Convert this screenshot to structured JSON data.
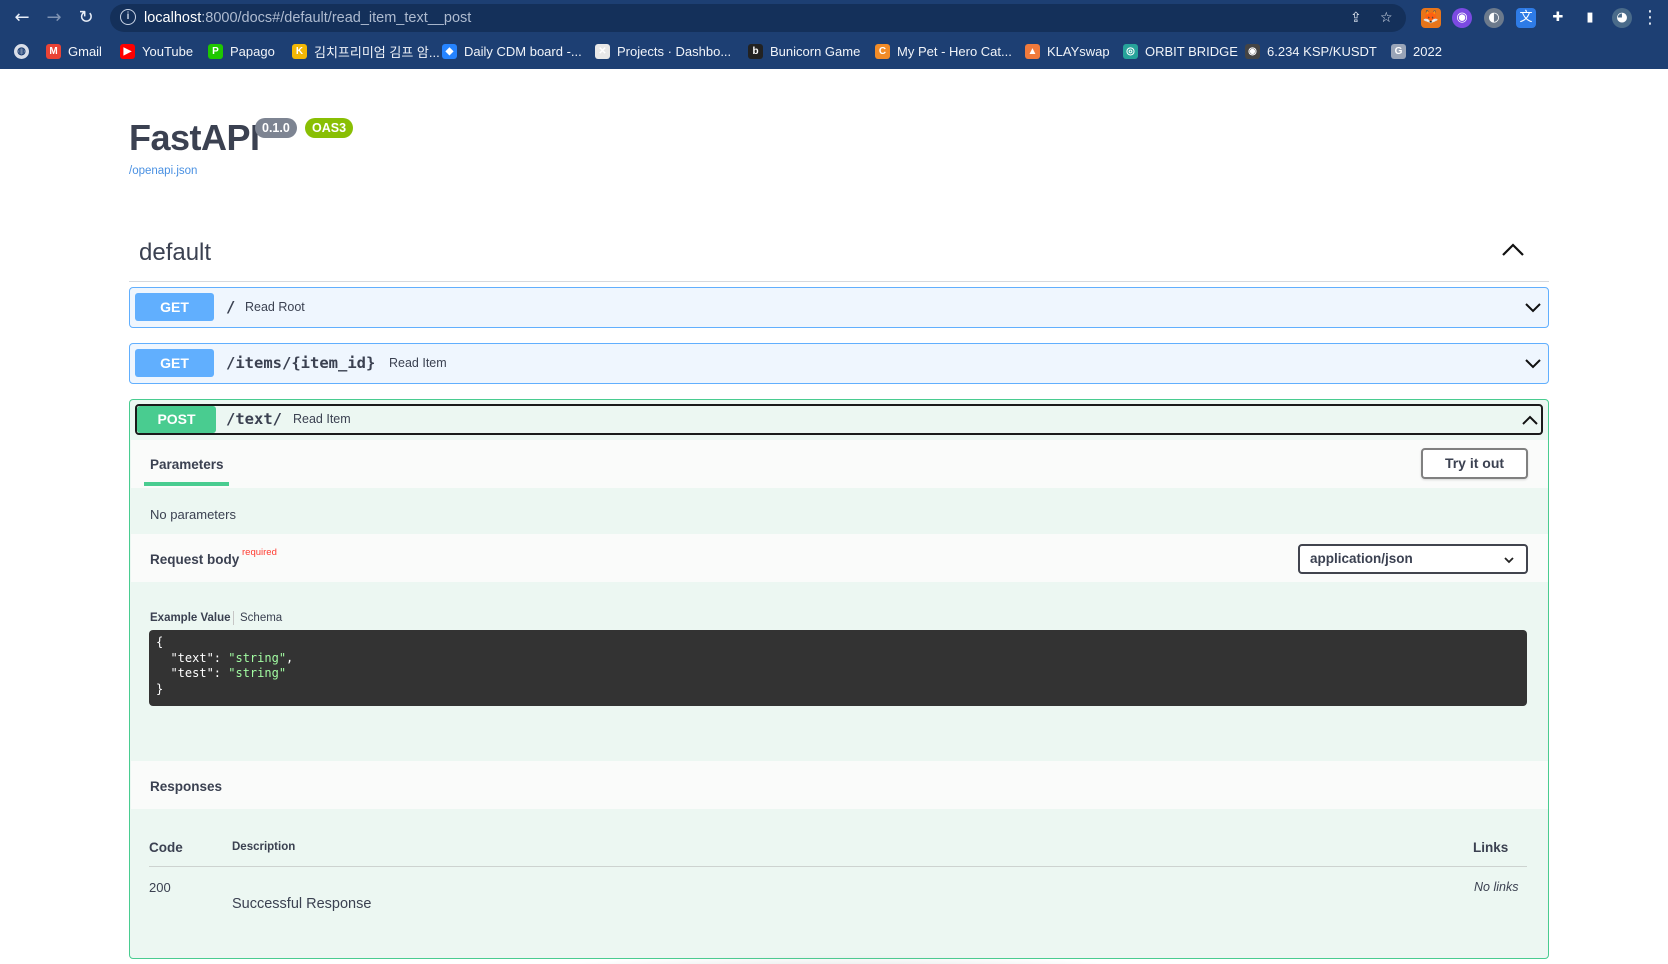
{
  "browser": {
    "url_host": "localhost",
    "url_rest": ":8000/docs#/default/read_item_text__post",
    "bookmarks": [
      {
        "label": "Gmail",
        "icon": "gmail-icon",
        "color": "#ea4335"
      },
      {
        "label": "YouTube",
        "icon": "youtube-icon",
        "color": "#ff0000"
      },
      {
        "label": "Papago",
        "icon": "papago-icon",
        "color": "#1ec800"
      },
      {
        "label": "김치프리미엄 김프 암...",
        "icon": "kimchi-icon",
        "color": "#f2b705"
      },
      {
        "label": "Daily CDM board -...",
        "icon": "jira-icon",
        "color": "#2684ff"
      },
      {
        "label": "Projects · Dashbo...",
        "icon": "projects-icon",
        "color": "#e8e8e8"
      },
      {
        "label": "Bunicorn Game",
        "icon": "bunicorn-icon",
        "color": "#222222"
      },
      {
        "label": "My Pet - Hero Cat...",
        "icon": "cat-icon",
        "color": "#f28c28"
      },
      {
        "label": "KLAYswap",
        "icon": "klayswap-icon",
        "color": "#f07a3c"
      },
      {
        "label": "ORBIT BRIDGE",
        "icon": "orbit-icon",
        "color": "#27a39a"
      },
      {
        "label": "6.234 KSP/KUSDT",
        "icon": "coin-icon",
        "color": "#444444"
      },
      {
        "label": "2022",
        "icon": "gid-icon",
        "color": "#9aa5b8"
      }
    ]
  },
  "swagger": {
    "title": "FastAPI",
    "version": "0.1.0",
    "oas": "OAS3",
    "spec_link": "/openapi.json",
    "tag": "default",
    "operations": [
      {
        "method": "GET",
        "path": "/",
        "summary": "Read Root"
      },
      {
        "method": "GET",
        "path": "/items/{item_id}",
        "summary": "Read Item"
      },
      {
        "method": "POST",
        "path": "/text/",
        "summary": "Read Item"
      }
    ],
    "expanded": {
      "parameters_label": "Parameters",
      "try_it_out": "Try it out",
      "no_parameters": "No parameters",
      "request_body_label": "Request body",
      "required_label": "required",
      "content_type": "application/json",
      "example_value_tab": "Example Value",
      "schema_tab": "Schema",
      "example_lines": [
        {
          "key": "",
          "value": "{"
        },
        {
          "key": "  \"text\": ",
          "value": "\"string\"",
          "suffix": ","
        },
        {
          "key": "  \"test\": ",
          "value": "\"string\"",
          "suffix": ""
        },
        {
          "key": "",
          "value": "}"
        }
      ],
      "responses_label": "Responses",
      "columns": {
        "code": "Code",
        "description": "Description",
        "links": "Links"
      },
      "responses": [
        {
          "code": "200",
          "description": "Successful Response",
          "links": "No links"
        }
      ]
    }
  },
  "colors": {
    "get": "#61affe",
    "post": "#49cc90",
    "chrome": "#1d3f73"
  }
}
